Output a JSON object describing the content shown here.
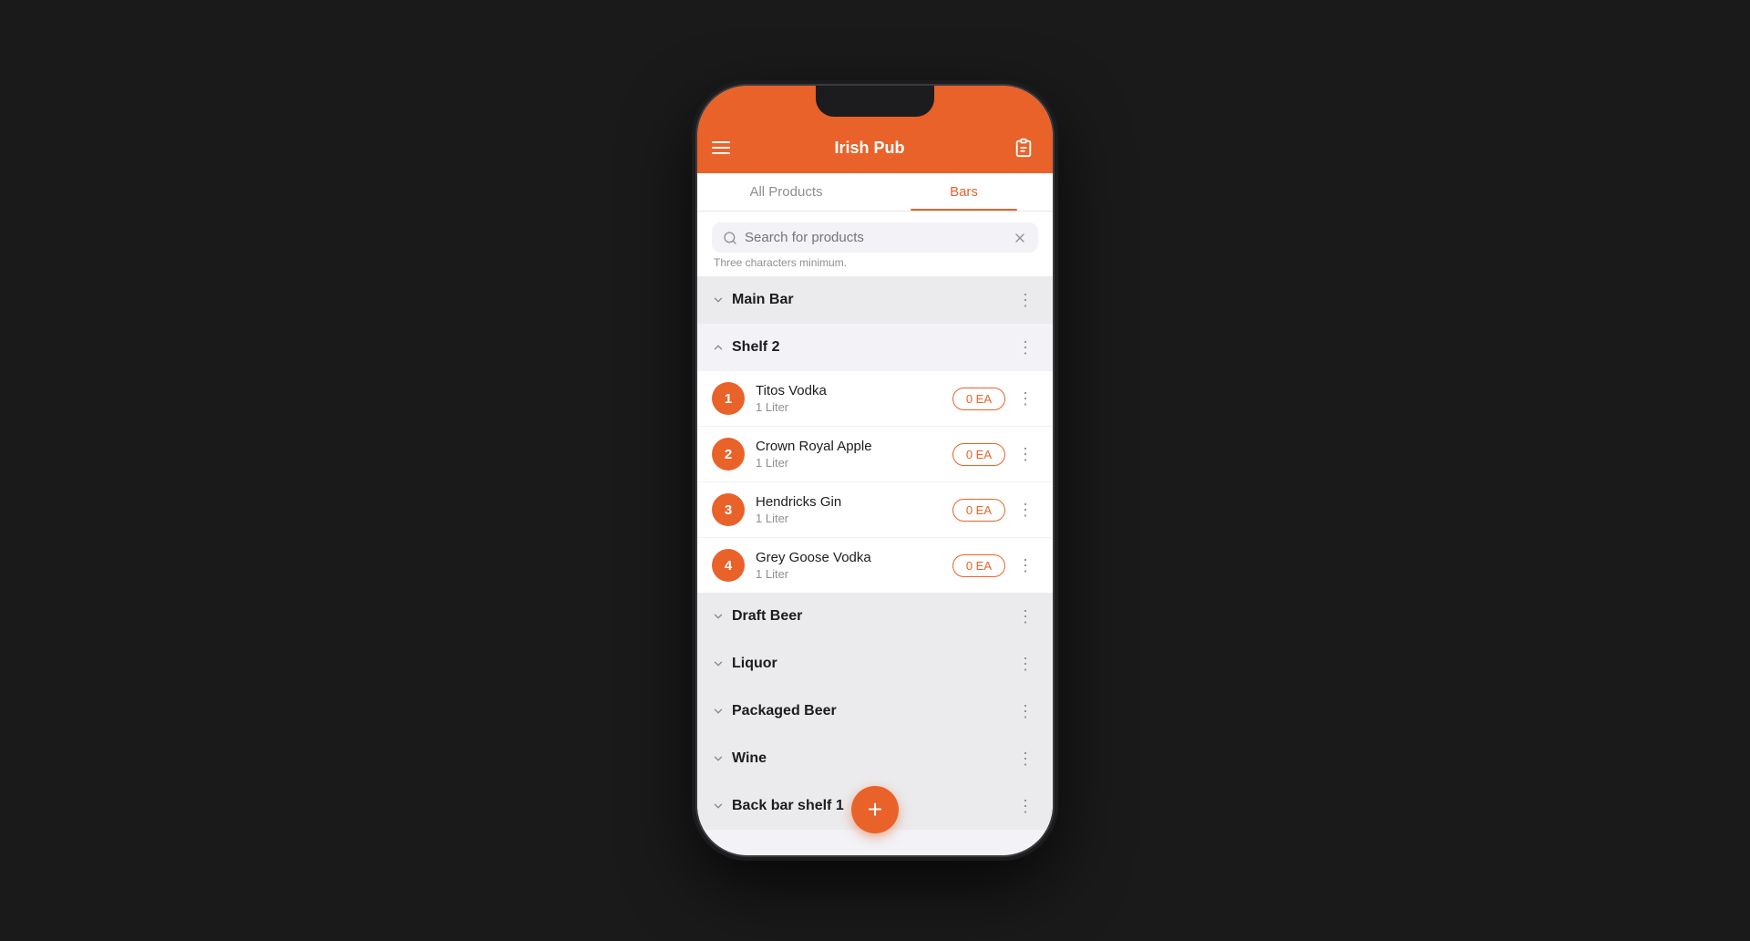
{
  "app": {
    "title": "Irish Pub",
    "tabs": [
      {
        "id": "all-products",
        "label": "All Products",
        "active": false
      },
      {
        "id": "bars",
        "label": "Bars",
        "active": true
      }
    ]
  },
  "search": {
    "placeholder": "Search for products",
    "hint": "Three characters minimum.",
    "value": ""
  },
  "sections": [
    {
      "id": "main-bar",
      "title": "Main Bar",
      "expanded": false,
      "items": []
    },
    {
      "id": "shelf-2",
      "title": "Shelf 2",
      "expanded": true,
      "items": [
        {
          "number": 1,
          "name": "Titos Vodka",
          "size": "1 Liter",
          "qty": "0 EA"
        },
        {
          "number": 2,
          "name": "Crown Royal Apple",
          "size": "1 Liter",
          "qty": "0 EA"
        },
        {
          "number": 3,
          "name": "Hendricks Gin",
          "size": "1 Liter",
          "qty": "0 EA"
        },
        {
          "number": 4,
          "name": "Grey Goose Vodka",
          "size": "1 Liter",
          "qty": "0 EA"
        }
      ]
    },
    {
      "id": "draft-beer",
      "title": "Draft Beer",
      "expanded": false,
      "items": []
    },
    {
      "id": "liquor",
      "title": "Liquor",
      "expanded": false,
      "items": []
    },
    {
      "id": "packaged-beer",
      "title": "Packaged Beer",
      "expanded": false,
      "items": []
    },
    {
      "id": "wine",
      "title": "Wine",
      "expanded": false,
      "items": []
    },
    {
      "id": "back-bar-shelf-1",
      "title": "Back bar shelf 1",
      "expanded": false,
      "items": []
    }
  ],
  "fab": {
    "label": "+"
  },
  "icons": {
    "hamburger": "☰",
    "clipboard": "📋",
    "search": "🔍",
    "clear": "✕",
    "chevron_down": "›",
    "chevron_up": "‹",
    "more": "⋮"
  },
  "colors": {
    "primary": "#E8622A",
    "text_primary": "#1c1c1e",
    "text_secondary": "#8e8e93",
    "background": "#f2f2f7",
    "white": "#ffffff"
  }
}
